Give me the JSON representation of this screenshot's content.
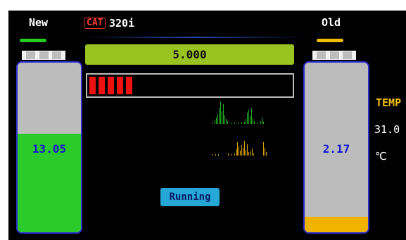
{
  "header": {
    "new_label": "New",
    "cat_badge": "CAT",
    "model": "320i",
    "old_label": "Old"
  },
  "counter": {
    "value": "5.000"
  },
  "progress": {
    "segments_filled": 5
  },
  "new_battery": {
    "value": "13.05",
    "fill_fraction": 0.58,
    "fill_color": "#2bcb2b"
  },
  "old_battery": {
    "value": "2.17",
    "fill_fraction": 0.09,
    "fill_color": "#f0b400"
  },
  "status": {
    "label": "Running"
  },
  "temperature": {
    "label": "TEMP",
    "value": "31.0",
    "unit": "℃"
  },
  "colors": {
    "accent_green": "#99c31e",
    "segment_red": "#ee1111",
    "status_blue": "#27a7d8"
  },
  "waveforms": {
    "top_color": "#1fae1f",
    "bottom_color": "#d9a000"
  }
}
